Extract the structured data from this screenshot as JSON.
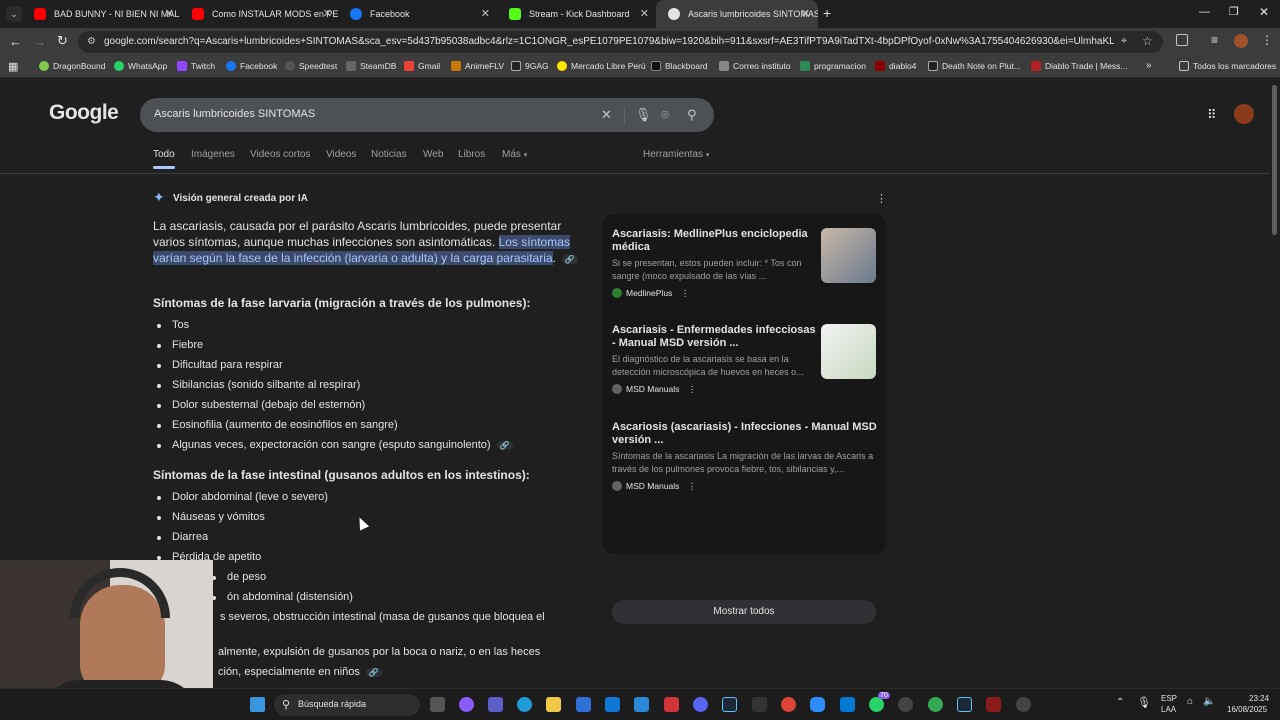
{
  "tabs": [
    {
      "label": "BAD BUNNY - NI BIEN NI MAL",
      "color": "#ff0000"
    },
    {
      "label": "Como INSTALAR MODS en PE",
      "color": "#ff0000"
    },
    {
      "label": "Facebook",
      "color": "#1877f2"
    },
    {
      "label": "Stream - Kick Dashboard",
      "color": "#53fc18"
    },
    {
      "label": "Ascaris lumbricoides SINTOMAS",
      "color": "#e3e3e3"
    }
  ],
  "url": "google.com/search?q=Ascaris+lumbricoides+SINTOMAS&sca_esv=5d437b95038adbc4&rlz=1C1ONGR_esPE1079PE1079&biw=1920&bih=911&sxsrf=AE3TifPT9A9iTadTXt-4bpDPfOyof-0xNw%3A1755404626930&ei=UlmhaKLJOJWYwbkPqcHls...",
  "bookmarks": [
    "DragonBound",
    "WhatsApp",
    "Twitch",
    "Facebook",
    "Speedtest",
    "SteamDB",
    "Gmail",
    "AnimeFLV",
    "9GAG",
    "Mercado Libre Perú",
    "Blackboard",
    "Correo instituto",
    "programacion",
    "diablo4",
    "Death Note on Plut...",
    "Diablo Trade | Mess...",
    "Todos los marcadores"
  ],
  "google": {
    "logo": "Google",
    "query": "Ascaris lumbricoides SINTOMAS"
  },
  "nav": {
    "tabs": [
      "Todo",
      "Imágenes",
      "Videos cortos",
      "Videos",
      "Noticias",
      "Web",
      "Libros",
      "Más"
    ],
    "tools": "Herramientas"
  },
  "ai": {
    "header": "Visión general creada por IA",
    "intro": "La ascariasis, causada por el parásito Ascaris lumbricoides, puede presentar varios síntomas, aunque muchas infecciones son asintomáticas. ",
    "highlight": "Los síntomas varían según la fase de la infección (larvaria o adulta) y la carga parasitaria",
    "s1_title": "Síntomas de la fase larvaria (migración a través de los pulmones):",
    "s1": [
      "Tos",
      "Fiebre",
      "Dificultad para respirar",
      "Sibilancias (sonido silbante al respirar)",
      "Dolor subesternal (debajo del esternón)",
      "Eosinofilia (aumento de eosinófilos en sangre)",
      "Algunas veces, expectoración con sangre (esputo sanguinolento)"
    ],
    "s2_title": "Síntomas de la fase intestinal (gusanos adultos en los intestinos):",
    "s2": [
      "Dolor abdominal (leve o severo)",
      "Náuseas y vómitos",
      "Diarrea",
      "Pérdida de apetito",
      "de peso",
      "ón abdominal (distensión)",
      "s severos, obstrucción intestinal (masa de gusanos que bloquea el",
      "almente, expulsión de gusanos por la boca o nariz, o en las heces",
      "ción, especialmente en niños"
    ]
  },
  "sources": [
    {
      "title": "Ascariasis: MedlinePlus enciclopedia médica",
      "snippet": "Si se presentan, estos pueden incluir: * Tos con sangre (moco expulsado de las vías ...",
      "source": "MedlinePlus"
    },
    {
      "title": "Ascariasis - Enfermedades infecciosas - Manual MSD versión ...",
      "snippet": "El diagnóstico de la ascariasis se basa en la detección microscópica de huevos en heces o...",
      "source": "MSD Manuals"
    },
    {
      "title": "Ascariosis (ascariasis) - Infecciones - Manual MSD versión ...",
      "snippet": "Síntomas de la ascariasis La migración de las larvas de Ascaris a través de los pulmones provoca fiebre, tos, sibilancias y,...",
      "source": "MSD Manuals"
    }
  ],
  "show_all": "Mostrar todos",
  "taskbar": {
    "search": "Búsqueda rápida",
    "lang": "ESP",
    "lang2": "LAA",
    "time": "23:24",
    "date": "16/08/2025",
    "badge": "70"
  }
}
